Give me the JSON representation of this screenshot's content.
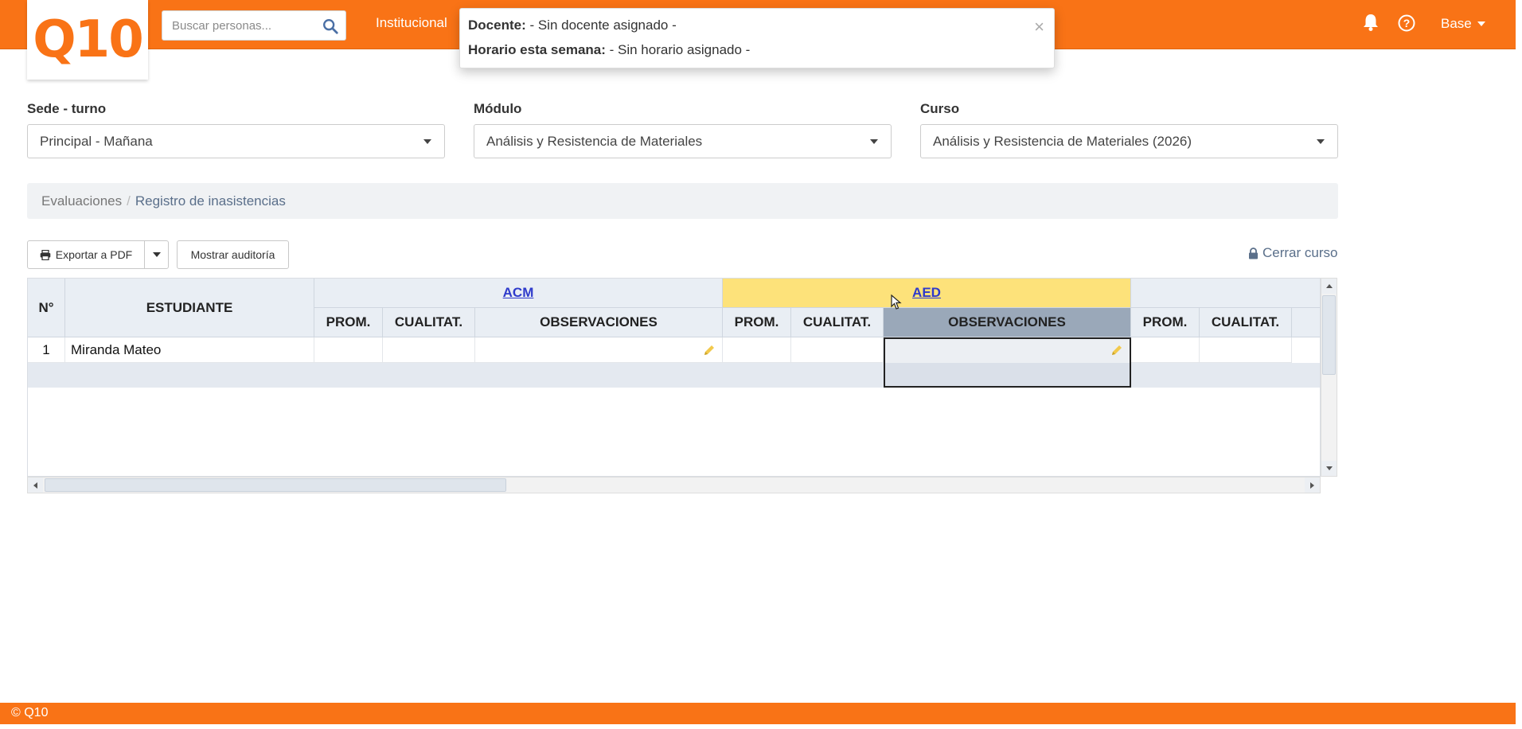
{
  "topbar": {
    "logo": "Q10",
    "search_placeholder": "Buscar personas...",
    "nav_item": "Institucional",
    "user_menu": "Base",
    "icons": [
      "bell-icon",
      "help-icon",
      "search-icon"
    ]
  },
  "popup": {
    "docente_label": "Docente:",
    "docente_value": " - Sin docente asignado -",
    "horario_label": "Horario esta semana:",
    "horario_value": " - Sin horario asignado -",
    "close": "×"
  },
  "filters": {
    "sede": {
      "label": "Sede - turno",
      "value": "Principal - Mañana"
    },
    "modulo": {
      "label": "Módulo",
      "value": "Análisis y Resistencia de Materiales"
    },
    "curso": {
      "label": "Curso",
      "value": "Análisis y Resistencia de Materiales (2026)"
    }
  },
  "breadcrumb": [
    "Evaluaciones",
    "Registro de inasistencias"
  ],
  "toolbar": {
    "export_label": "Exportar a PDF",
    "audit_label": "Mostrar auditoría",
    "close_course": "Cerrar curso"
  },
  "grid": {
    "col_num": "N°",
    "col_student": "ESTUDIANTE",
    "groups": [
      "ACM",
      "AED"
    ],
    "sub_headers": [
      "PROM.",
      "CUALITAT.",
      "OBSERVACIONES"
    ],
    "rows": [
      {
        "num": "1",
        "student": "Miranda Mateo"
      }
    ]
  },
  "footer": "© Q10",
  "colors": {
    "accent": "#f97316",
    "highlight": "#fde27a",
    "link": "#2e3acb"
  }
}
